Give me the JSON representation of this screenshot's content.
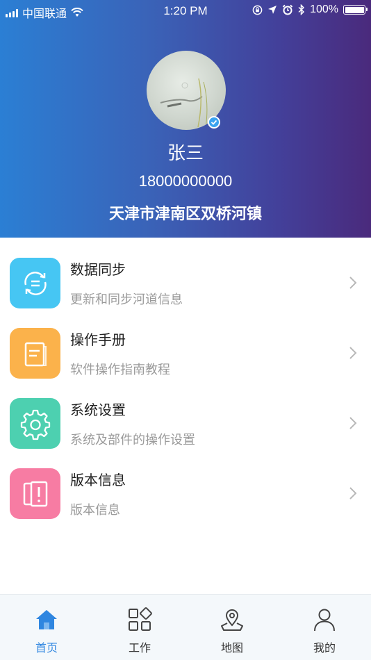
{
  "status_bar": {
    "carrier": "中国联通",
    "time": "1:20 PM",
    "battery_percent": "100%"
  },
  "profile": {
    "name": "张三",
    "phone": "18000000000",
    "address": "天津市津南区双桥河镇"
  },
  "menu": [
    {
      "title": "数据同步",
      "subtitle": "更新和同步河道信息",
      "icon": "sync-icon",
      "color": "#46c6f3"
    },
    {
      "title": "操作手册",
      "subtitle": "软件操作指南教程",
      "icon": "manual-icon",
      "color": "#fbb24b"
    },
    {
      "title": "系统设置",
      "subtitle": "系统及部件的操作设置",
      "icon": "gear-icon",
      "color": "#4dd0b0"
    },
    {
      "title": "版本信息",
      "subtitle": "版本信息",
      "icon": "version-info-icon",
      "color": "#f77ca3"
    }
  ],
  "tabs": [
    {
      "label": "首页",
      "icon": "home-icon",
      "active": true
    },
    {
      "label": "工作",
      "icon": "apps-grid-icon",
      "active": false
    },
    {
      "label": "地图",
      "icon": "map-pin-icon",
      "active": false
    },
    {
      "label": "我的",
      "icon": "user-icon",
      "active": false
    }
  ],
  "colors": {
    "header_gradient_start": "#2b7fd4",
    "header_gradient_end": "#4a2a7c",
    "tab_active": "#2f86e0"
  }
}
